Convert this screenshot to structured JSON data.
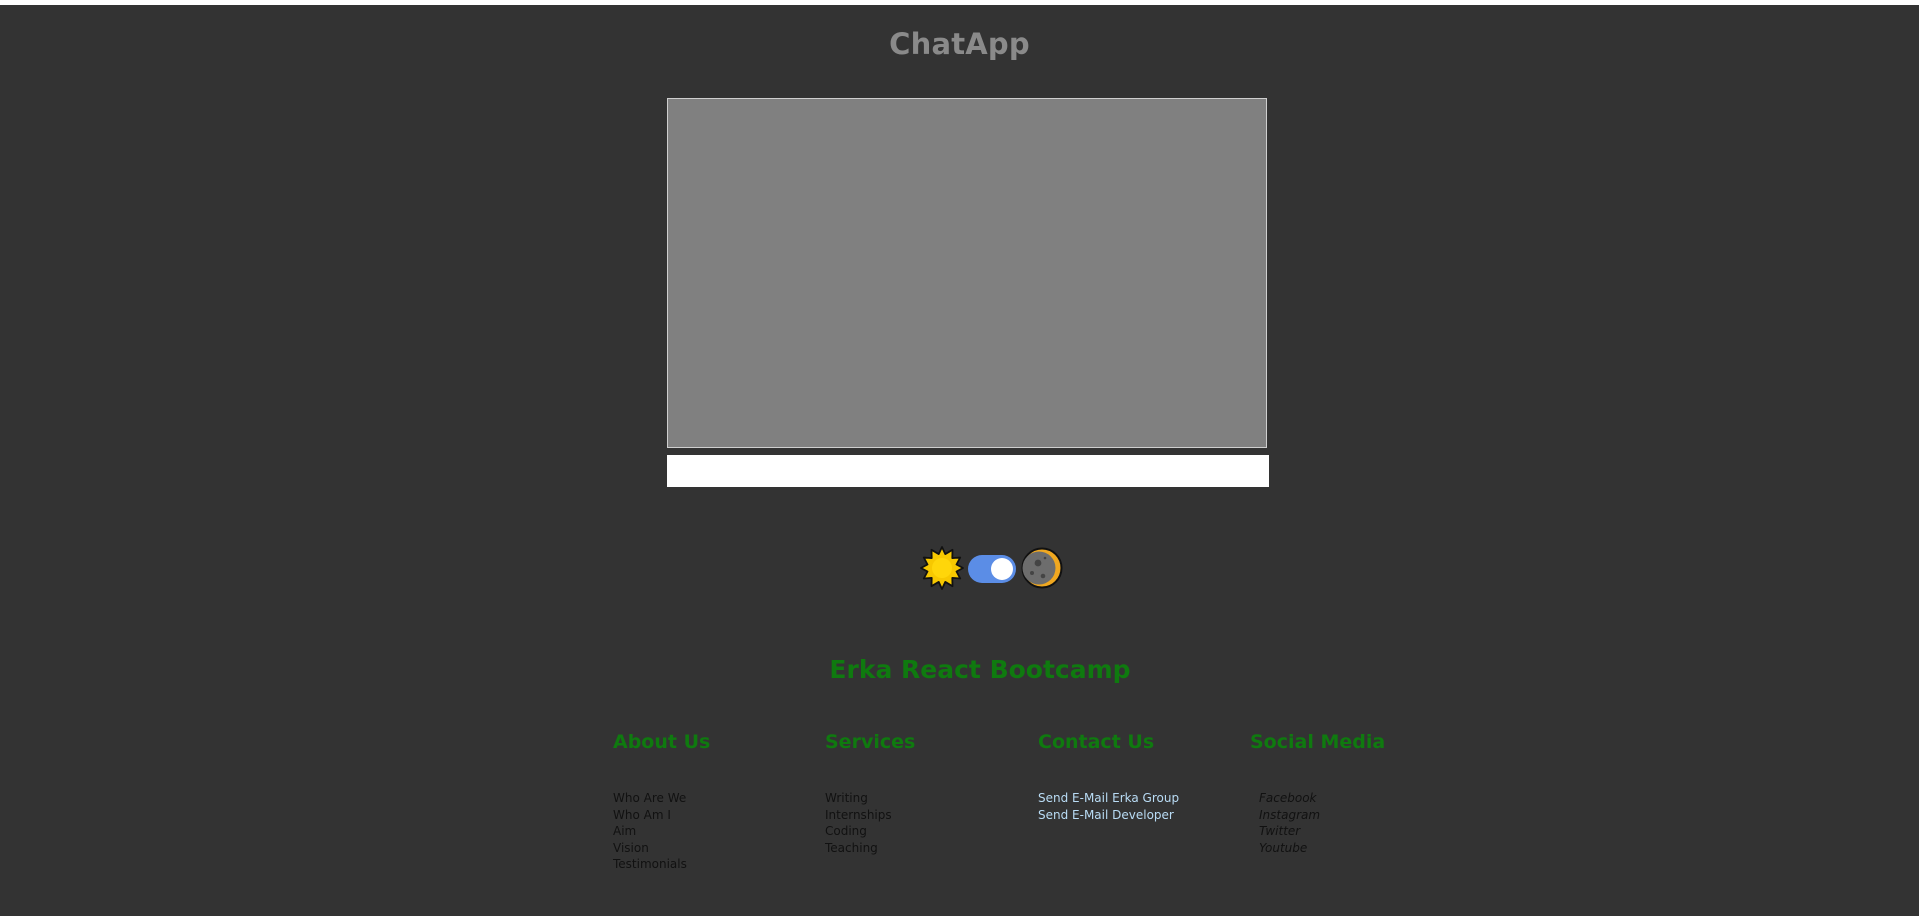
{
  "app": {
    "title": "ChatApp"
  },
  "chat": {
    "input_value": "",
    "input_placeholder": ""
  },
  "theme_toggle": {
    "state": "on",
    "icons": [
      "sun-icon",
      "toggle-switch",
      "moon-icon"
    ]
  },
  "footer": {
    "title": "Erka React Bootcamp",
    "columns": {
      "about": {
        "heading": "About Us",
        "items": [
          "Who Are We",
          "Who Am I",
          "Aim",
          "Vision",
          "Testimonials"
        ]
      },
      "services": {
        "heading": "Services",
        "items": [
          "Writing",
          "Internships",
          "Coding",
          "Teaching"
        ]
      },
      "contact": {
        "heading": "Contact Us",
        "items": [
          "Send E-Mail Erka Group",
          "Send E-Mail Developer"
        ]
      },
      "social": {
        "heading": "Social Media",
        "items": [
          "Facebook",
          "Instagram",
          "Twitter",
          "Youtube"
        ]
      }
    }
  },
  "colors": {
    "background": "#333333",
    "title": "#8a8a8a",
    "chat_window": "#808080",
    "footer_accent": "#0f7a0f",
    "contact_link": "#b9dcf5",
    "toggle": "#5b8de6"
  }
}
